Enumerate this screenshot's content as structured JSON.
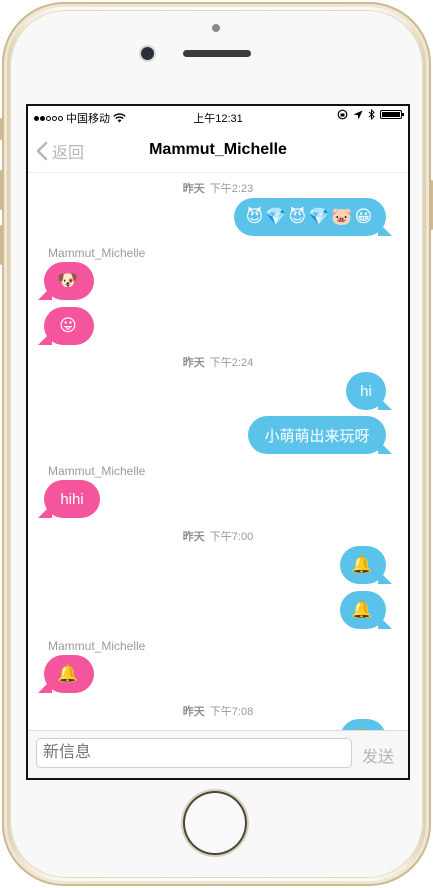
{
  "status_bar": {
    "carrier": "中国移动",
    "time": "上午12:31"
  },
  "nav": {
    "back_label": "返回",
    "title": "Mammut_Michelle"
  },
  "messages": [
    {
      "type": "timestamp",
      "day": "昨天",
      "time": "下午2:23"
    },
    {
      "type": "outgoing",
      "text": "😈💎😈💎🐷😀"
    },
    {
      "type": "sender",
      "name": "Mammut_Michelle"
    },
    {
      "type": "incoming",
      "text": "🐶"
    },
    {
      "type": "incoming",
      "text": "😛"
    },
    {
      "type": "timestamp",
      "day": "昨天",
      "time": "下午2:24"
    },
    {
      "type": "outgoing",
      "text": "hi"
    },
    {
      "type": "outgoing",
      "text": "小萌萌出来玩呀"
    },
    {
      "type": "sender",
      "name": "Mammut_Michelle"
    },
    {
      "type": "incoming",
      "text": "hihi"
    },
    {
      "type": "timestamp",
      "day": "昨天",
      "time": "下午7:00"
    },
    {
      "type": "outgoing",
      "text": "🔔"
    },
    {
      "type": "outgoing",
      "text": "🔔"
    },
    {
      "type": "sender",
      "name": "Mammut_Michelle"
    },
    {
      "type": "incoming",
      "text": "🔔"
    },
    {
      "type": "timestamp",
      "day": "昨天",
      "time": "下午7:08"
    },
    {
      "type": "outgoing",
      "text": "🔔"
    }
  ],
  "composer": {
    "placeholder": "新信息",
    "send_label": "发送"
  },
  "colors": {
    "outgoing_bubble": "#5bc3ea",
    "incoming_bubble": "#f5559c"
  }
}
